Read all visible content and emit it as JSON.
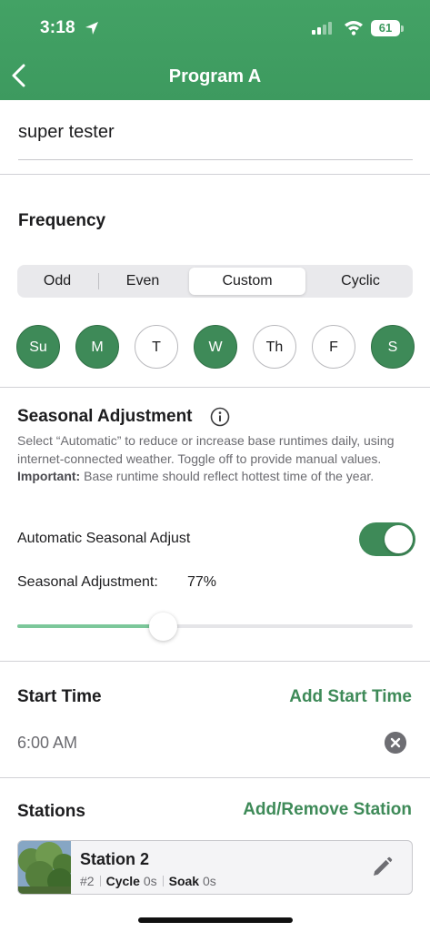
{
  "status_bar": {
    "time": "3:18",
    "battery": "61"
  },
  "header": {
    "title": "Program A"
  },
  "program": {
    "name": "super tester"
  },
  "frequency": {
    "title": "Frequency",
    "options": [
      "Odd",
      "Even",
      "Custom",
      "Cyclic"
    ],
    "selected": "Custom",
    "days": [
      {
        "label": "Su",
        "on": true
      },
      {
        "label": "M",
        "on": true
      },
      {
        "label": "T",
        "on": false
      },
      {
        "label": "W",
        "on": true
      },
      {
        "label": "Th",
        "on": false
      },
      {
        "label": "F",
        "on": false
      },
      {
        "label": "S",
        "on": true
      }
    ]
  },
  "seasonal": {
    "title": "Seasonal Adjustment",
    "description_1": "Select “Automatic” to reduce or increase base runtimes daily, using internet-connected weather. Toggle off to provide manual values. ",
    "important_label": "Important:",
    "description_2": " Base runtime should reflect hottest time of the year.",
    "auto_label": "Automatic Seasonal Adjust",
    "auto_enabled": true,
    "adjust_label": "Seasonal Adjustment:",
    "adjust_value": "77%",
    "slider_level": 0.37
  },
  "start_time": {
    "title": "Start Time",
    "add_label": "Add Start Time",
    "times": [
      "6:00 AM"
    ]
  },
  "stations": {
    "title": "Stations",
    "add_label": "Add/Remove Station",
    "items": [
      {
        "name": "Station 2",
        "number": "#2",
        "cycle_label": "Cycle",
        "cycle_value": "0s",
        "soak_label": "Soak",
        "soak_value": "0s"
      }
    ]
  },
  "colors": {
    "accent": "#3e8a58",
    "header": "#3d9a5f"
  }
}
